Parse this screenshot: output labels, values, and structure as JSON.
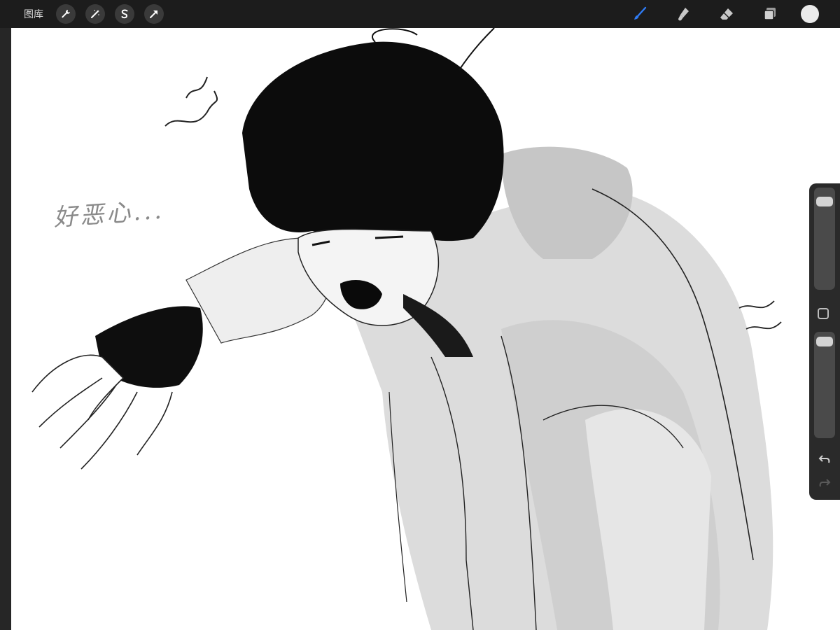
{
  "toolbar": {
    "gallery_label": "图库",
    "left_tools": [
      "wrench-icon",
      "magic-wand-icon",
      "selection-icon",
      "transform-arrow-icon"
    ],
    "right_tools": [
      "brush-icon",
      "smudge-icon",
      "eraser-icon",
      "layers-icon",
      "color-swatch"
    ],
    "active_tool": "brush-icon",
    "accent_color": "#2f7cf6",
    "current_color": "#eaeaea"
  },
  "canvas": {
    "handwritten_note": "好恶心..."
  },
  "sidebar": {
    "brush_size_level": 0.08,
    "opacity_level": 0.03,
    "controls": [
      "brush-size-slider",
      "modify-button",
      "opacity-slider",
      "undo-icon",
      "redo-icon"
    ]
  }
}
